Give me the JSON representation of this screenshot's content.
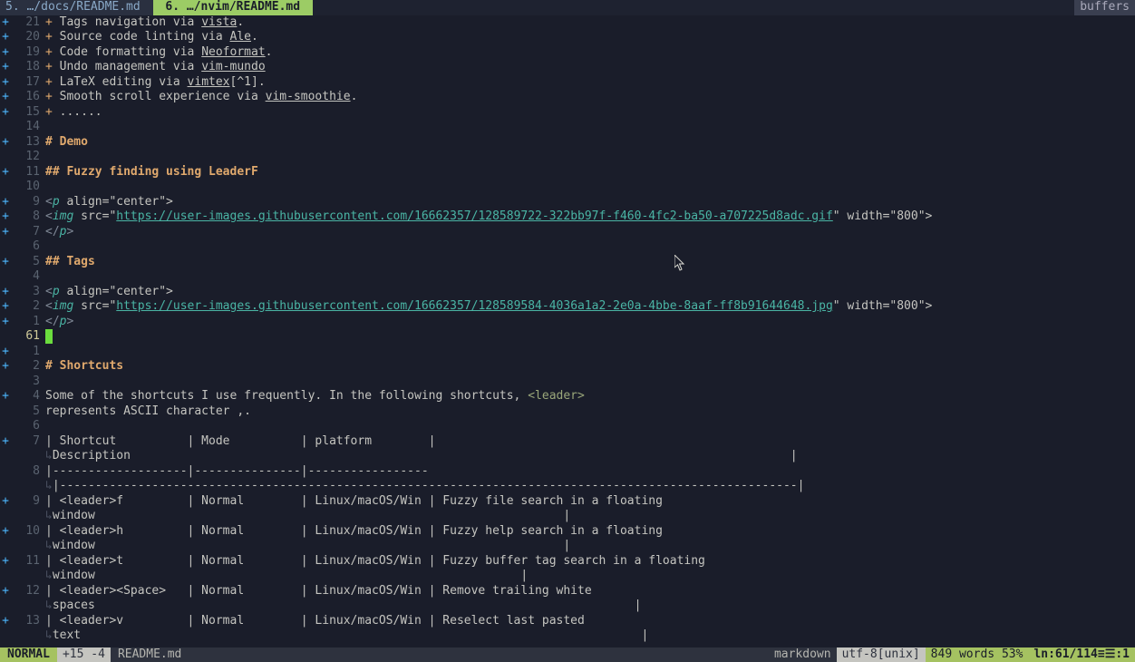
{
  "tabs": {
    "inactive": "5. …/docs/README.md ",
    "active": " 6. …/nvim/README.md ",
    "right": "buffers"
  },
  "lines": {
    "l21": {
      "num": "21",
      "sign": "+",
      "pre": "+ ",
      "text": "Tags navigation via ",
      "u": "vista",
      "post": "."
    },
    "l20": {
      "num": "20",
      "sign": "+",
      "pre": "+ ",
      "text": "Source code linting via ",
      "u": "Ale",
      "post": "."
    },
    "l19": {
      "num": "19",
      "sign": "+",
      "pre": "+ ",
      "text": "Code formatting via ",
      "u": "Neoformat",
      "post": "."
    },
    "l18": {
      "num": "18",
      "sign": "+",
      "pre": "+ ",
      "text": "Undo management via ",
      "u": "vim-mundo",
      "post": ""
    },
    "l17": {
      "num": "17",
      "sign": "+",
      "pre": "+ ",
      "text": "LaTeX editing via ",
      "u": "vimtex",
      "post": "[^1]."
    },
    "l16": {
      "num": "16",
      "sign": "+",
      "pre": "+ ",
      "text": "Smooth scroll experience via ",
      "u": "vim-smoothie",
      "post": "."
    },
    "l15": {
      "num": "15",
      "sign": "+",
      "pre": "+ ",
      "text": "......",
      "u": "",
      "post": ""
    },
    "l14": {
      "num": "14",
      "sign": ""
    },
    "l13": {
      "num": "13",
      "sign": "+",
      "h": "# ",
      "ht": "Demo"
    },
    "l12": {
      "num": "12",
      "sign": ""
    },
    "l11": {
      "num": "11",
      "sign": "+",
      "h": "## ",
      "ht": "Fuzzy finding using LeaderF"
    },
    "l10": {
      "num": "10",
      "sign": ""
    },
    "l9a": {
      "num": "9",
      "sign": "+",
      "tag_open": "<",
      "tag_name": "p",
      "tag_rest": " align=\"center\">"
    },
    "l8a": {
      "num": "8",
      "sign": "+",
      "img_pre": "<",
      "img_tag": "img",
      "img_src_attr": " src=\"",
      "img_url": "https://user-images.githubusercontent.com/16662357/128589722-322bb97f-f460-4fc2-ba50-a707225d8adc.gif",
      "img_post": "\" width=\"800\">"
    },
    "l7a": {
      "num": "7",
      "sign": "+",
      "close": "</",
      "close_tag": "p",
      "close_end": ">"
    },
    "l6a": {
      "num": "6",
      "sign": ""
    },
    "l5a": {
      "num": "5",
      "sign": "+",
      "h": "## ",
      "ht": "Tags"
    },
    "l4a": {
      "num": "4",
      "sign": ""
    },
    "l3a": {
      "num": "3",
      "sign": "+",
      "tag_open": "<",
      "tag_name": "p",
      "tag_rest": " align=\"center\">"
    },
    "l2a": {
      "num": "2",
      "sign": "+",
      "img_pre": "<",
      "img_tag": "img",
      "img_src_attr": " src=\"",
      "img_url": "https://user-images.githubusercontent.com/16662357/128589584-4036a1a2-2e0a-4bbe-8aaf-ff8b91644648.jpg",
      "img_post": "\" width=\"800\">"
    },
    "l1a": {
      "num": "1",
      "sign": "+",
      "close": "</",
      "close_tag": "p",
      "close_end": ">"
    },
    "cur": {
      "num": "61",
      "sign": ""
    },
    "l1b": {
      "num": "1",
      "sign": "+"
    },
    "l2b": {
      "num": "2",
      "sign": "+",
      "h": "# ",
      "ht": "Shortcuts"
    },
    "l3b": {
      "num": "3",
      "sign": ""
    },
    "l4b": {
      "num": "4",
      "sign": "+",
      "text": "Some of the shortcuts I use frequently. In the following shortcuts, ",
      "code": "<leader>"
    },
    "l5b": {
      "num": "5",
      "sign": "",
      "text": "represents ASCII character ,."
    },
    "l6b": {
      "num": "6",
      "sign": ""
    },
    "l7b": {
      "num": "7",
      "sign": "+",
      "text": "| Shortcut          | Mode          | platform        |"
    },
    "l7bw": {
      "text": "Description                                                                                             |"
    },
    "l8b": {
      "num": "8",
      "sign": "",
      "text": "|-------------------|---------------|-----------------"
    },
    "l8bw": {
      "text": "|--------------------------------------------------------------------------------------------------------|"
    },
    "l9b": {
      "num": "9",
      "sign": "+",
      "text": "| <leader>f         | Normal        | Linux/macOS/Win | Fuzzy file search in a floating"
    },
    "l9bw": {
      "text": "window                                                                  |"
    },
    "l10b": {
      "num": "10",
      "sign": "+",
      "text": "| <leader>h         | Normal        | Linux/macOS/Win | Fuzzy help search in a floating"
    },
    "l10bw": {
      "text": "window                                                                  |"
    },
    "l11b": {
      "num": "11",
      "sign": "+",
      "text": "| <leader>t         | Normal        | Linux/macOS/Win | Fuzzy buffer tag search in a floating"
    },
    "l11bw": {
      "text": "window                                                            |"
    },
    "l12b": {
      "num": "12",
      "sign": "+",
      "text": "| <leader><Space>   | Normal        | Linux/macOS/Win | Remove trailing white"
    },
    "l12bw": {
      "text": "spaces                                                                            |"
    },
    "l13b": {
      "num": "13",
      "sign": "+",
      "text": "| <leader>v         | Normal        | Linux/macOS/Win | Reselect last pasted"
    },
    "l13bw": {
      "text": "text                                                                               |"
    }
  },
  "status": {
    "mode": "NORMAL",
    "git": " +15 -4 ",
    "file": "README.md",
    "filetype": "markdown",
    "encoding": "utf-8[unix]",
    "words": "849 words 53%",
    "pos": "ln:61/114≡☰:1"
  },
  "wrap_char": "↳"
}
